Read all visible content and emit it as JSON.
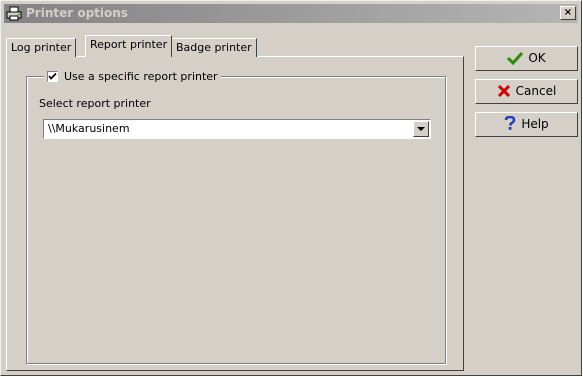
{
  "window": {
    "title": "Printer options",
    "close_glyph": "×"
  },
  "tabs": [
    {
      "label": "Log printer",
      "active": false
    },
    {
      "label": "Report printer",
      "active": true
    },
    {
      "label": "Badge printer",
      "active": false
    }
  ],
  "report_printer": {
    "use_specific_label": "Use a specific report printer",
    "use_specific_checked": true,
    "select_label": "Select report printer",
    "selected_printer": "\\\\Mukarusinem"
  },
  "buttons": {
    "ok": {
      "label": "OK",
      "icon": "checkmark-icon",
      "color": "#2e8b00"
    },
    "cancel": {
      "label": "Cancel",
      "icon": "x-icon",
      "color": "#d00000"
    },
    "help": {
      "label": "Help",
      "icon": "question-icon",
      "color": "#1f3fbf"
    }
  }
}
